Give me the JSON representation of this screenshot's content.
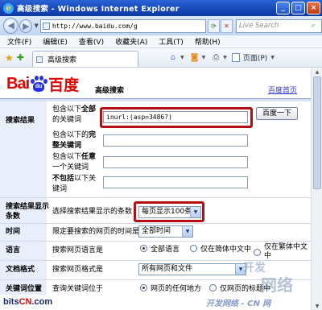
{
  "window": {
    "title": "高级搜索 - Windows Internet Explorer",
    "buttons": [
      "_",
      "□",
      "×"
    ]
  },
  "address_bar": {
    "url": "http://www.baidu.com/g",
    "search_placeholder": "Live Search"
  },
  "menu": [
    "文件(F)",
    "编辑(E)",
    "查看(V)",
    "收藏夹(A)",
    "工具(T)",
    "帮助(H)"
  ],
  "tab": {
    "label": "高级搜索"
  },
  "toolbar": {
    "page_menu": "页面(P)"
  },
  "page": {
    "logo": {
      "bai": "Bai",
      "du": "du",
      "cn": "百度"
    },
    "title": "高级搜索",
    "home_link": "百度首页",
    "sections": {
      "results": {
        "label": "搜索结果",
        "fields": [
          {
            "label_pre": "包含以下",
            "label_bold": "全部",
            "label_post": "的关键词",
            "value": "inurl:(asp=3486?)"
          },
          {
            "label_pre": "包含以下的",
            "label_bold": "完整关键词",
            "label_post": "",
            "value": ""
          },
          {
            "label_pre": "包含以下",
            "label_bold": "任意",
            "label_post": "一个关键词",
            "value": ""
          },
          {
            "label_pre": "",
            "label_bold": "不包括",
            "label_post": "以下关键词",
            "value": ""
          }
        ],
        "submit": "百度一下"
      },
      "count": {
        "label": "搜索结果显示条数",
        "text": "选择搜索结果显示的条数",
        "selected": "每页显示100条"
      },
      "time": {
        "label": "时间",
        "text": "限定要搜索的网页的时间是",
        "selected": "全部时间"
      },
      "language": {
        "label": "语言",
        "text": "搜索网页语言是",
        "options": [
          "全部语言",
          "仅在简体中文中",
          "仅在繁体中文中"
        ],
        "selected_index": 0
      },
      "format": {
        "label": "文档格式",
        "text": "搜索网页格式是",
        "selected": "所有网页和文件"
      },
      "position": {
        "label": "关键词位置",
        "text": "查询关键词位于",
        "options": [
          "网页的任何地方",
          "仅网页的标题中"
        ],
        "selected_index": 0
      }
    }
  },
  "watermarks": {
    "left_brand": "bitsCN.com",
    "left_brand_parts": [
      "bits",
      "CN",
      ".com"
    ],
    "right_credit": "开发网络 - CN 网",
    "stamp_lines": [
      "开发",
      "网络"
    ]
  },
  "colors": {
    "title_bar": "#1746b8",
    "highlight_frame": "#b40f12",
    "baidu_red": "#e10602",
    "baidu_blue": "#2932e1",
    "left_panel": "#e8eefa",
    "link": "#3636cc"
  }
}
